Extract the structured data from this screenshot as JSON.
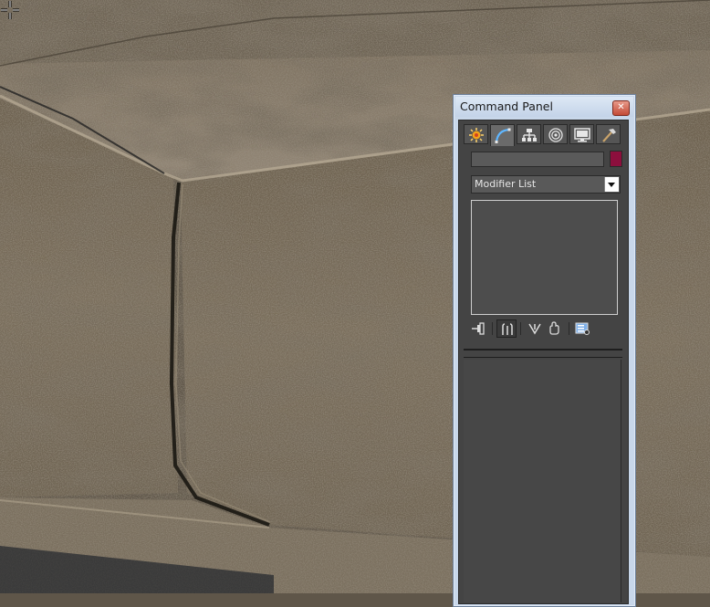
{
  "command_panel": {
    "title": "Command Panel",
    "close_glyph": "✕",
    "tabs": [
      {
        "name": "create",
        "icon": "create-star-icon"
      },
      {
        "name": "modify",
        "icon": "modify-arc-icon",
        "active": true
      },
      {
        "name": "hierarchy",
        "icon": "hierarchy-icon"
      },
      {
        "name": "motion",
        "icon": "motion-wheel-icon"
      },
      {
        "name": "display",
        "icon": "display-monitor-icon"
      },
      {
        "name": "utilities",
        "icon": "utilities-hammer-icon"
      }
    ],
    "name_field_value": "",
    "object_color": "#8c0f3d",
    "modifier_list": {
      "label": "Modifier List"
    },
    "stack_tools": [
      {
        "name": "pin-stack",
        "icon": "pin-stack-icon"
      },
      {
        "name": "show-end-result",
        "icon": "show-end-result-icon",
        "pressed": true
      },
      {
        "name": "make-unique",
        "icon": "make-unique-icon"
      },
      {
        "name": "remove-modifier",
        "icon": "remove-modifier-icon"
      },
      {
        "name": "configure-modifier-sets",
        "icon": "configure-sets-icon"
      }
    ]
  },
  "colors": {
    "panel_bg": "#444444",
    "window_frame": "#c8d7ea",
    "stone_base": "#6b6150"
  }
}
